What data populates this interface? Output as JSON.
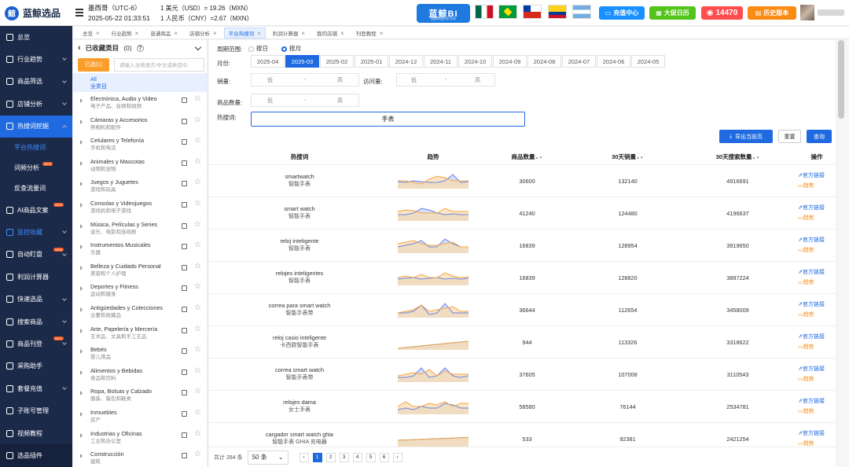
{
  "app": {
    "name": "蓝鲸选品",
    "logo_glyph": "鲸"
  },
  "header": {
    "tz_name": "墨西哥（UTC-6）",
    "tz_time": "2025-05-22 01:33:51",
    "rate_usd": "1 美元（USD）= 19.26（MXN）",
    "rate_cny": "1 人民币（CNY）=2.67（MXN）",
    "bi_label": "蓝鲸BI",
    "bi_sub": "蓝鲸数据分析专家",
    "buttons": [
      {
        "label": "充值中心",
        "icon": "card-icon",
        "color": "#1890ff"
      },
      {
        "label": "大促日历",
        "icon": "calendar-icon",
        "color": "#52c41a"
      },
      {
        "label": "14470",
        "icon": "coin-icon",
        "color": "#ff4d4f"
      },
      {
        "label": "历史版本",
        "icon": "history-icon",
        "color": "#fa8c16"
      }
    ],
    "flags": [
      "mexico-flag",
      "brazil-flag",
      "chile-flag",
      "colombia-flag",
      "argentina-flag"
    ]
  },
  "sidebar": {
    "new_tag": "NEW",
    "items": [
      {
        "label": "总览",
        "icon": "home-icon"
      },
      {
        "label": "行业趋势",
        "icon": "trend-icon",
        "arrow": "down"
      },
      {
        "label": "商品筛选",
        "icon": "grid-icon",
        "arrow": "down"
      },
      {
        "label": "店铺分析",
        "icon": "store-icon",
        "arrow": "down"
      },
      {
        "label": "热搜词挖掘",
        "icon": "fire-icon",
        "arrow": "up",
        "state": "active"
      },
      {
        "label": "平台热搜词",
        "sub": true,
        "state": "current"
      },
      {
        "label": "词频分析",
        "sub": true,
        "new": true
      },
      {
        "label": "反查流量词",
        "sub": true
      },
      {
        "label": "AI商品文案",
        "icon": "ai-icon",
        "new": true
      },
      {
        "label": "监控收藏",
        "icon": "monitor-icon",
        "arrow": "down",
        "state": "blue"
      },
      {
        "label": "自动盯盘",
        "icon": "robot-icon",
        "arrow": "down",
        "new": true
      },
      {
        "label": "利润计算器",
        "icon": "calc-icon"
      },
      {
        "label": "快速选品",
        "icon": "bolt-icon",
        "arrow": "down"
      },
      {
        "label": "搜索商品",
        "icon": "search-icon",
        "arrow": "down"
      },
      {
        "label": "商品刊登",
        "icon": "upload-icon",
        "arrow": "down",
        "new": true
      },
      {
        "label": "采购助手",
        "icon": "cart-icon"
      },
      {
        "label": "套餐充值",
        "icon": "package-icon",
        "arrow": "down"
      },
      {
        "label": "子账号管理",
        "icon": "users-icon"
      },
      {
        "label": "视频教程",
        "icon": "video-icon"
      },
      {
        "label": "选品插件",
        "icon": "plugin-icon",
        "state": "dark"
      }
    ]
  },
  "tabs": [
    {
      "label": "总览"
    },
    {
      "label": "行业趋势"
    },
    {
      "label": "普通商品"
    },
    {
      "label": "店铺分析"
    },
    {
      "label": "平台热搜词",
      "active": true
    },
    {
      "label": "利润计算器"
    },
    {
      "label": "我的店铺"
    },
    {
      "label": "刊登教程"
    }
  ],
  "categories": {
    "title": "已收藏类目",
    "count": "(0)",
    "selected_label": "已选(1)",
    "search_placeholder": "请输入当地语言/中文或类目ID",
    "all": {
      "es": "All",
      "zh": "全类目"
    },
    "items": [
      {
        "es": "Electrónica, Audio y Video",
        "zh": "电子产品、音频和视频"
      },
      {
        "es": "Cámaras y Accesorios",
        "zh": "照相机和配件"
      },
      {
        "es": "Celulares y Telefonía",
        "zh": "手机和电话"
      },
      {
        "es": "Animales y Mascotas",
        "zh": "动物和宠物"
      },
      {
        "es": "Juegos y Juguetes",
        "zh": "游戏和玩具"
      },
      {
        "es": "Consolas y Videojuegos",
        "zh": "游戏机和电子游戏"
      },
      {
        "es": "Música, Películas y Series",
        "zh": "音乐、电影和连续剧"
      },
      {
        "es": "Instrumentos Musicales",
        "zh": "乐器"
      },
      {
        "es": "Belleza y Cuidado Personal",
        "zh": "美容和个人护理"
      },
      {
        "es": "Deportes y Fitness",
        "zh": "运动和健身"
      },
      {
        "es": "Antigüedades y Colecciones",
        "zh": "古董和收藏品"
      },
      {
        "es": "Arte, Papelería y Mercería",
        "zh": "艺术品、文具和手工艺品"
      },
      {
        "es": "Bebés",
        "zh": "婴儿用品"
      },
      {
        "es": "Alimentos y Bebidas",
        "zh": "食品和饮料"
      },
      {
        "es": "Ropa, Bolsas y Calzado",
        "zh": "服装、箱包和鞋类"
      },
      {
        "es": "Inmuebles",
        "zh": "房产"
      },
      {
        "es": "Industrias y Oficinas",
        "zh": "工业和办公室"
      },
      {
        "es": "Construcción",
        "zh": "建筑"
      }
    ]
  },
  "filters": {
    "period_label": "周期范围:",
    "period_day": "按日",
    "period_month": "按月",
    "month_label": "月份:",
    "months": [
      "2025-04",
      "2025-03",
      "2025-02",
      "2025-01",
      "2024-12",
      "2024-11",
      "2024-10",
      "2024-09",
      "2024-08",
      "2024-07",
      "2024-06",
      "2024-05"
    ],
    "active_month": "2025-03",
    "sales_label": "销量:",
    "visits_label": "访问量:",
    "qty_label": "商品数量:",
    "low": "低",
    "high": "高",
    "dash": "-",
    "keyword_label": "热搜词:",
    "keyword_value": "手表",
    "export_label": "导出当前页",
    "reset_label": "重置",
    "query_label": "查询"
  },
  "table": {
    "headers": {
      "kw": "热搜词",
      "trend": "趋势",
      "qty": "商品数量",
      "sales": "30天销量",
      "search": "30天搜索数量",
      "ops": "操作"
    },
    "link_label": "官方链接",
    "trend_label": "趋势",
    "rows": [
      {
        "es": "smartwatch",
        "zh": "智能手表",
        "qty": "30600",
        "sales": "132140",
        "search": "4916691"
      },
      {
        "es": "smart watch",
        "zh": "智能手表",
        "qty": "41240",
        "sales": "124480",
        "search": "4196637"
      },
      {
        "es": "reloj inteligente",
        "zh": "智能手表",
        "qty": "16839",
        "sales": "128954",
        "search": "3919650"
      },
      {
        "es": "relojes inteligentes",
        "zh": "智能手表",
        "qty": "16839",
        "sales": "128820",
        "search": "3897224"
      },
      {
        "es": "correa para smart watch",
        "zh": "智能手表带",
        "qty": "36644",
        "sales": "112654",
        "search": "3458009"
      },
      {
        "es": "reloj casio inteligente",
        "zh": "卡西欧智能手表",
        "qty": "944",
        "sales": "113326",
        "search": "3318622"
      },
      {
        "es": "correa smart watch",
        "zh": "智能手表带",
        "qty": "37605",
        "sales": "107008",
        "search": "3110543"
      },
      {
        "es": "relojes dama",
        "zh": "女士手表",
        "qty": "58580",
        "sales": "76144",
        "search": "2534781"
      },
      {
        "es": "cargador smart watch ghia",
        "zh": "智能手表 GHIA 充电器",
        "qty": "533",
        "sales": "92381",
        "search": "2421254"
      }
    ]
  },
  "pager": {
    "total": "共计 284 条",
    "size": "50 条",
    "pages": [
      "1",
      "2",
      "3",
      "4",
      "5",
      "6"
    ],
    "active": "1",
    "prev": "‹",
    "next": "›"
  },
  "colors": {
    "primary": "#1f6ae0",
    "series_blue": "#6b84e8",
    "series_orange": "#f0a64a"
  }
}
